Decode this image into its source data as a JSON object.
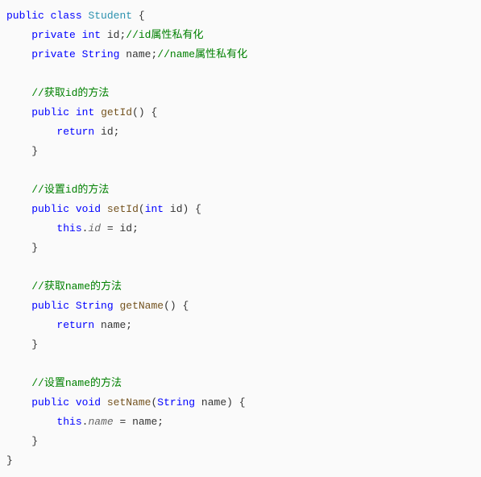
{
  "code": {
    "kw_public": "public",
    "kw_private": "private",
    "kw_class": "class",
    "kw_int": "int",
    "kw_String": "String",
    "kw_void": "void",
    "kw_return": "return",
    "kw_this": "this",
    "cls_Student": "Student",
    "field_id": "id",
    "field_name": "name",
    "m_getId": "getId",
    "m_setId": "setId",
    "m_getName": "getName",
    "m_setName": "setName",
    "c_id_priv": "//id属性私有化",
    "c_name_priv": "//name属性私有化",
    "c_get_id": "//获取id的方法",
    "c_set_id": "//设置id的方法",
    "c_get_name": "//获取name的方法",
    "c_set_name": "//设置name的方法",
    "brace_open": "{",
    "brace_close": "}",
    "paren_open": "(",
    "paren_close": ")",
    "semi": ";",
    "eq": " = ",
    "dot": ".",
    "sp": " "
  }
}
